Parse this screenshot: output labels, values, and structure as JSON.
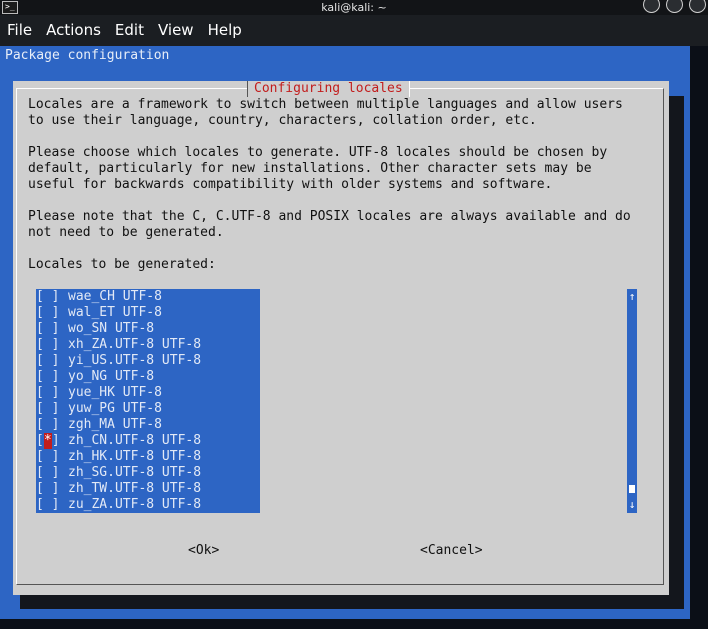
{
  "window": {
    "title": "kali@kali: ~",
    "menu": [
      "File",
      "Actions",
      "Edit",
      "View",
      "Help"
    ]
  },
  "terminal": {
    "package_title": "Package configuration"
  },
  "dialog": {
    "title": "Configuring locales",
    "paragraphs": [
      "Locales are a framework to switch between multiple languages and allow users",
      "to use their language, country, characters, collation order, etc.",
      "",
      "Please choose which locales to generate. UTF-8 locales should be chosen by",
      "default, particularly for new installations. Other character sets may be",
      "useful for backwards compatibility with older systems and software.",
      "",
      "Please note that the C, C.UTF-8 and POSIX locales are always available and do",
      "not need to be generated.",
      "",
      "Locales to be generated:"
    ],
    "locales": [
      {
        "label": "wae_CH UTF-8",
        "checked": false
      },
      {
        "label": "wal_ET UTF-8",
        "checked": false
      },
      {
        "label": "wo_SN UTF-8",
        "checked": false
      },
      {
        "label": "xh_ZA.UTF-8 UTF-8",
        "checked": false
      },
      {
        "label": "yi_US.UTF-8 UTF-8",
        "checked": false
      },
      {
        "label": "yo_NG UTF-8",
        "checked": false
      },
      {
        "label": "yue_HK UTF-8",
        "checked": false
      },
      {
        "label": "yuw_PG UTF-8",
        "checked": false
      },
      {
        "label": "zgh_MA UTF-8",
        "checked": false
      },
      {
        "label": "zh_CN.UTF-8 UTF-8",
        "checked": true
      },
      {
        "label": "zh_HK.UTF-8 UTF-8",
        "checked": false
      },
      {
        "label": "zh_SG.UTF-8 UTF-8",
        "checked": false
      },
      {
        "label": "zh_TW.UTF-8 UTF-8",
        "checked": false
      },
      {
        "label": "zu_ZA.UTF-8 UTF-8",
        "checked": false
      }
    ],
    "ok_label": "<Ok>",
    "cancel_label": "<Cancel>",
    "scroll_up_glyph": "↑",
    "scroll_down_glyph": "↓"
  },
  "colors": {
    "terminal_blue": "#2d65c4",
    "dialog_gray": "#cfcfcf",
    "accent_red": "#c21d1d"
  }
}
